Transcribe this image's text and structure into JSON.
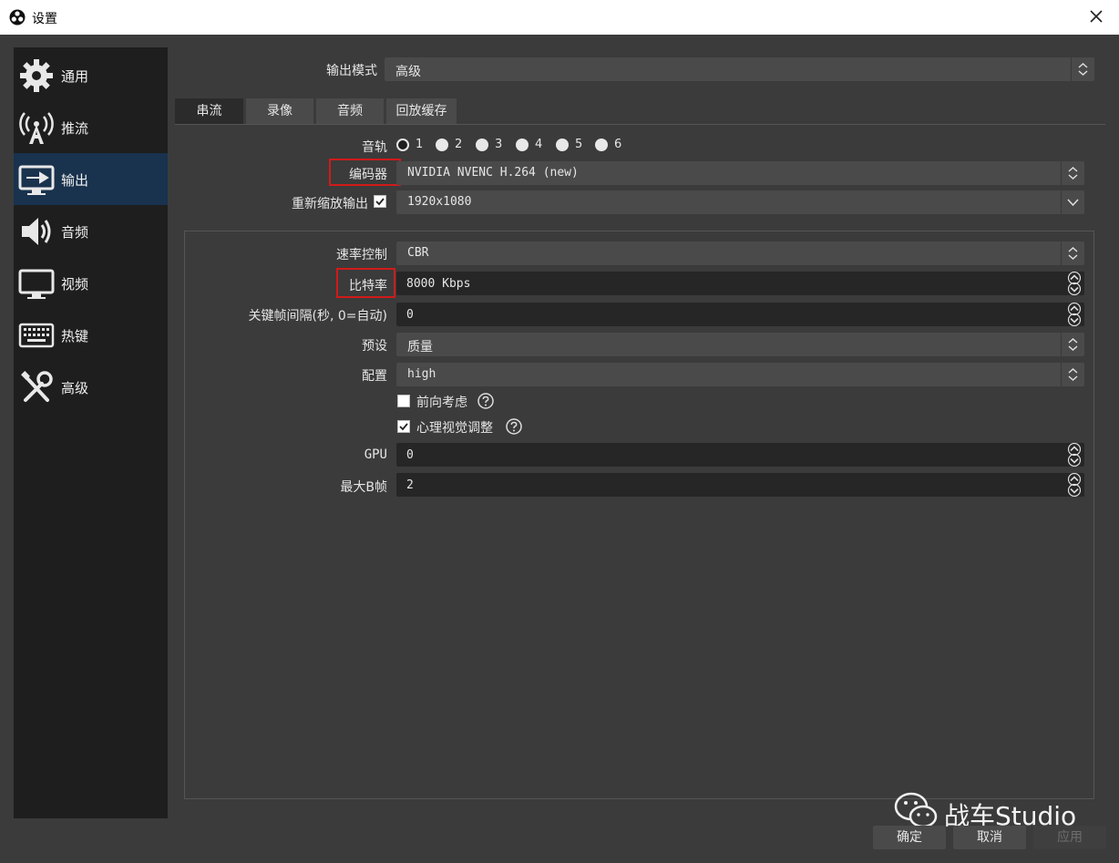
{
  "window": {
    "title": "设置"
  },
  "sidebar": {
    "items": [
      {
        "label": "通用",
        "icon": "gear-icon"
      },
      {
        "label": "推流",
        "icon": "broadcast-antenna-icon"
      },
      {
        "label": "输出",
        "icon": "output-monitor-icon",
        "active": true
      },
      {
        "label": "音频",
        "icon": "speaker-icon"
      },
      {
        "label": "视频",
        "icon": "monitor-icon"
      },
      {
        "label": "热键",
        "icon": "keyboard-icon"
      },
      {
        "label": "高级",
        "icon": "tools-icon"
      }
    ]
  },
  "output_mode": {
    "label": "输出模式",
    "value": "高级"
  },
  "tabs": [
    {
      "label": "串流",
      "active": true
    },
    {
      "label": "录像"
    },
    {
      "label": "音频"
    },
    {
      "label": "回放缓存"
    }
  ],
  "audio_track": {
    "label": "音轨",
    "options": [
      "1",
      "2",
      "3",
      "4",
      "5",
      "6"
    ],
    "selected": "1"
  },
  "encoder": {
    "label": "编码器",
    "value": "NVIDIA NVENC H.264 (new)"
  },
  "rescale": {
    "label": "重新缩放输出",
    "checked": true,
    "value": "1920x1080"
  },
  "settings": {
    "rate_control": {
      "label": "速率控制",
      "value": "CBR"
    },
    "bitrate": {
      "label": "比特率",
      "value": "8000 Kbps"
    },
    "keyframe": {
      "label": "关键帧间隔(秒, 0=自动)",
      "value": "0"
    },
    "preset": {
      "label": "预设",
      "value": "质量"
    },
    "profile": {
      "label": "配置",
      "value": "high"
    },
    "lookahead": {
      "label": "前向考虑",
      "checked": false
    },
    "psycho": {
      "label": "心理视觉调整",
      "checked": true
    },
    "gpu": {
      "label": "GPU",
      "value": "0"
    },
    "bframes": {
      "label": "最大B帧",
      "value": "2"
    }
  },
  "buttons": {
    "ok": "确定",
    "cancel": "取消",
    "apply": "应用"
  },
  "watermark": {
    "text": "战车Studio"
  },
  "colors": {
    "highlight_box": "#d11a1a",
    "active_sidebar": "#19324d"
  }
}
